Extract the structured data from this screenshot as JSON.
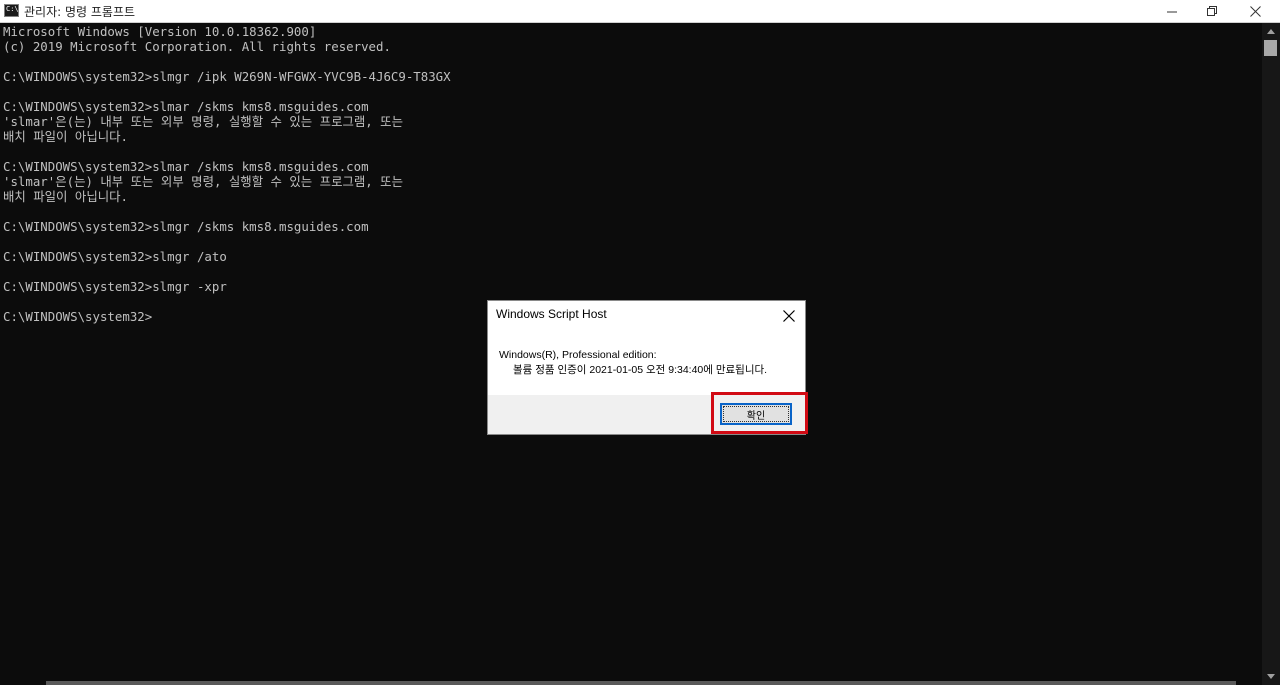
{
  "window": {
    "title": "관리자: 명령 프롬프트",
    "icon": "console-icon",
    "icon_label": "C:\\"
  },
  "console": {
    "lines": [
      "Microsoft Windows [Version 10.0.18362.900]",
      "(c) 2019 Microsoft Corporation. All rights reserved.",
      "",
      "C:\\WINDOWS\\system32>slmgr /ipk W269N-WFGWX-YVC9B-4J6C9-T83GX",
      "",
      "C:\\WINDOWS\\system32>slmar /skms kms8.msguides.com",
      "'slmar'은(는) 내부 또는 외부 명령, 실행할 수 있는 프로그램, 또는",
      "배치 파일이 아닙니다.",
      "",
      "C:\\WINDOWS\\system32>slmar /skms kms8.msguides.com",
      "'slmar'은(는) 내부 또는 외부 명령, 실행할 수 있는 프로그램, 또는",
      "배치 파일이 아닙니다.",
      "",
      "C:\\WINDOWS\\system32>slmgr /skms kms8.msguides.com",
      "",
      "C:\\WINDOWS\\system32>slmgr /ato",
      "",
      "C:\\WINDOWS\\system32>slmgr -xpr",
      "",
      "C:\\WINDOWS\\system32>"
    ]
  },
  "dialog": {
    "title": "Windows Script Host",
    "message_line1": "Windows(R), Professional edition:",
    "message_line2": "볼륨 정품 인증이 2021-01-05 오전 9:34:40에 만료됩니다.",
    "ok_label": "확인",
    "highlight_color": "#d10a14"
  },
  "colors": {
    "console_bg": "#0c0c0c",
    "console_text": "#c0c0c0",
    "focus_border": "#0a64c8"
  }
}
